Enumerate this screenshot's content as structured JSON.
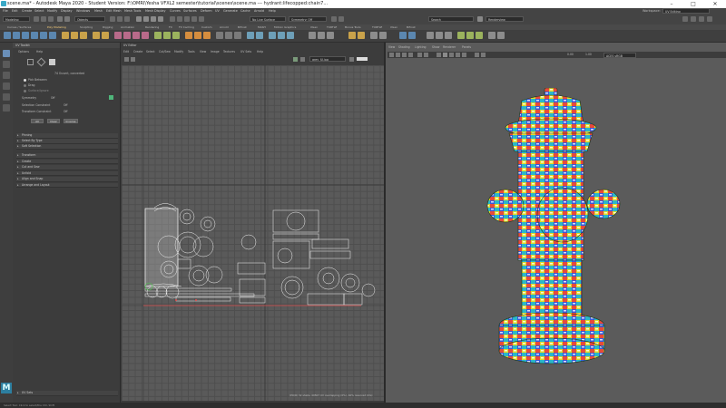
{
  "window": {
    "title": "scene.ma* - Autodesk Maya 2020 - Student Version: F:\\OMRI\\Yesha VFXL2 semester\\tutorial\\scenes\\scene.ma  ---  hydrant:lifecopped:chain7...",
    "minimize": "–",
    "maximize": "□",
    "close": "✕"
  },
  "menubar": [
    "File",
    "Edit",
    "Create",
    "Select",
    "Modify",
    "Display",
    "Windows",
    "Mesh",
    "Edit Mesh",
    "Mesh Tools",
    "Mesh Display",
    "Curves",
    "Surfaces",
    "Deform",
    "UV",
    "Generate",
    "Cache",
    "Arnold",
    "Help"
  ],
  "workspace": {
    "label": "Workspace:",
    "value": "UV Editing"
  },
  "statusline": {
    "menuset": "Modeling",
    "objects": "Objects",
    "symmetry": "Symmetry: Off",
    "live_surface": "No Live Surface",
    "search_placeholder": "Search",
    "render_label": "Renderview"
  },
  "shelf_tabs": [
    "Curves / Surfaces",
    "Poly Modeling",
    "Sculpting",
    "Rigging",
    "Animation",
    "Rendering",
    "FX",
    "FX Caching",
    "Custom",
    "Arnold",
    "Bifrost",
    "MASH",
    "Motion Graphics",
    "XGen",
    "TURTLE",
    "Bonus Tools",
    "TURTLE",
    "XGen",
    "Bifrost"
  ],
  "uv_toolkit": {
    "title": "UV Toolkit",
    "menus": [
      "Options",
      "Help"
    ],
    "uv_count": "74 Ouvert, converted",
    "pick_options": [
      "Pick Between",
      "Drag",
      "Surface/Ignore"
    ],
    "symmetry_label": "Symmetry",
    "symmetry_value": "Off",
    "selection_constraint": "Selection Constraint",
    "selection_constraint_value": "Off",
    "transform_constraint": "Transform Constraint",
    "transform_constraint_value": "Off",
    "buttons": [
      "All",
      "Clear",
      "Inverse"
    ],
    "sections_a": [
      "Pinning",
      "Select By Type",
      "Soft Selection"
    ],
    "sections_b": [
      "Transform",
      "Create",
      "Cut and Sew",
      "Unfold",
      "Align and Snap",
      "Arrange and Layout"
    ],
    "uv_sets": "UV Sets"
  },
  "uv_editor": {
    "title": "UV Editor",
    "menus": [
      "Edit",
      "Create",
      "Select",
      "Cut/Sew",
      "Modify",
      "Tools",
      "View",
      "Image",
      "Textures",
      "UV Sets",
      "Help"
    ],
    "texture_field": "grey_IU.jpg",
    "status": "(PO(R) 32 shells, 40507 UV overlapping (0%), 40% reserved UVs)"
  },
  "viewport": {
    "menus": [
      "View",
      "Shading",
      "Lighting",
      "Show",
      "Renderer",
      "Panels"
    ],
    "camera": "persp",
    "near_value": "0.00",
    "far_value": "1.00",
    "color_space": "ACES sRGB"
  },
  "help_line": "Select Tool: Click to select/the Ctrl, Shift"
}
